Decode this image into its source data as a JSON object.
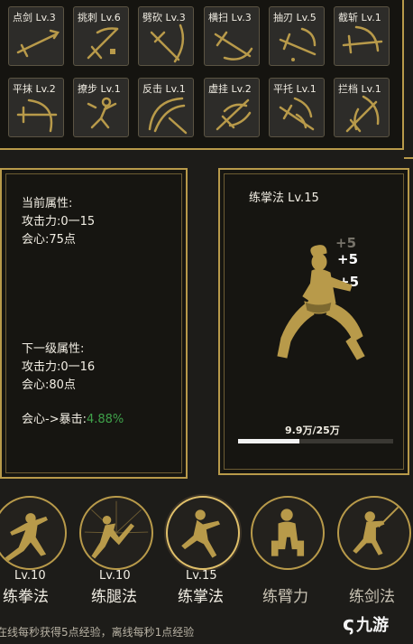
{
  "skills": [
    {
      "label": "点剑 Lv.3",
      "icon": "sword-thrust-icon"
    },
    {
      "label": "挑刺 Lv.6",
      "icon": "upward-stab-icon"
    },
    {
      "label": "劈砍 Lv.3",
      "icon": "chop-icon"
    },
    {
      "label": "横扫 Lv.3",
      "icon": "sweep-icon"
    },
    {
      "label": "抽刃 Lv.5",
      "icon": "draw-blade-icon"
    },
    {
      "label": "截斩 Lv.1",
      "icon": "intercept-slash-icon"
    },
    {
      "label": "平抹 Lv.2",
      "icon": "flat-wipe-icon"
    },
    {
      "label": "撩步 Lv.1",
      "icon": "lift-step-icon"
    },
    {
      "label": "反击 Lv.1",
      "icon": "counter-icon"
    },
    {
      "label": "虚挂 Lv.2",
      "icon": "feint-hang-icon"
    },
    {
      "label": "平托 Lv.1",
      "icon": "flat-lift-icon"
    },
    {
      "label": "拦档 Lv.1",
      "icon": "block-icon"
    }
  ],
  "stats": {
    "current_header": "当前属性:",
    "current_attack": "攻击力:0一15",
    "current_crit": "会心:75点",
    "next_header": "下一级属性:",
    "next_attack": "攻击力:0一16",
    "next_crit": "会心:80点",
    "crit_label": "会心->暴击:",
    "crit_value": "4.88%"
  },
  "training": {
    "title": "练掌法 Lv.15",
    "gains": [
      "+5",
      "+5",
      "+5"
    ],
    "progress_text": "9.9万/25万",
    "progress": 0.396
  },
  "techniques": [
    {
      "name": "练拳法",
      "level": "Lv.10",
      "icon": "fist-stance-icon"
    },
    {
      "name": "练腿法",
      "level": "Lv.10",
      "icon": "kick-icon"
    },
    {
      "name": "练掌法",
      "level": "Lv.15",
      "icon": "palm-stance-icon"
    },
    {
      "name": "练臂力",
      "level": "",
      "icon": "arm-strength-icon"
    },
    {
      "name": "练剑法",
      "level": "",
      "icon": "sword-practice-icon"
    }
  ],
  "footer_note": "在线每秒获得5点经验，离线每秒1点经验",
  "watermark": "九游",
  "colors": {
    "gold": "#b89a4a",
    "green": "#3fa14a",
    "background": "#1d1c19"
  }
}
